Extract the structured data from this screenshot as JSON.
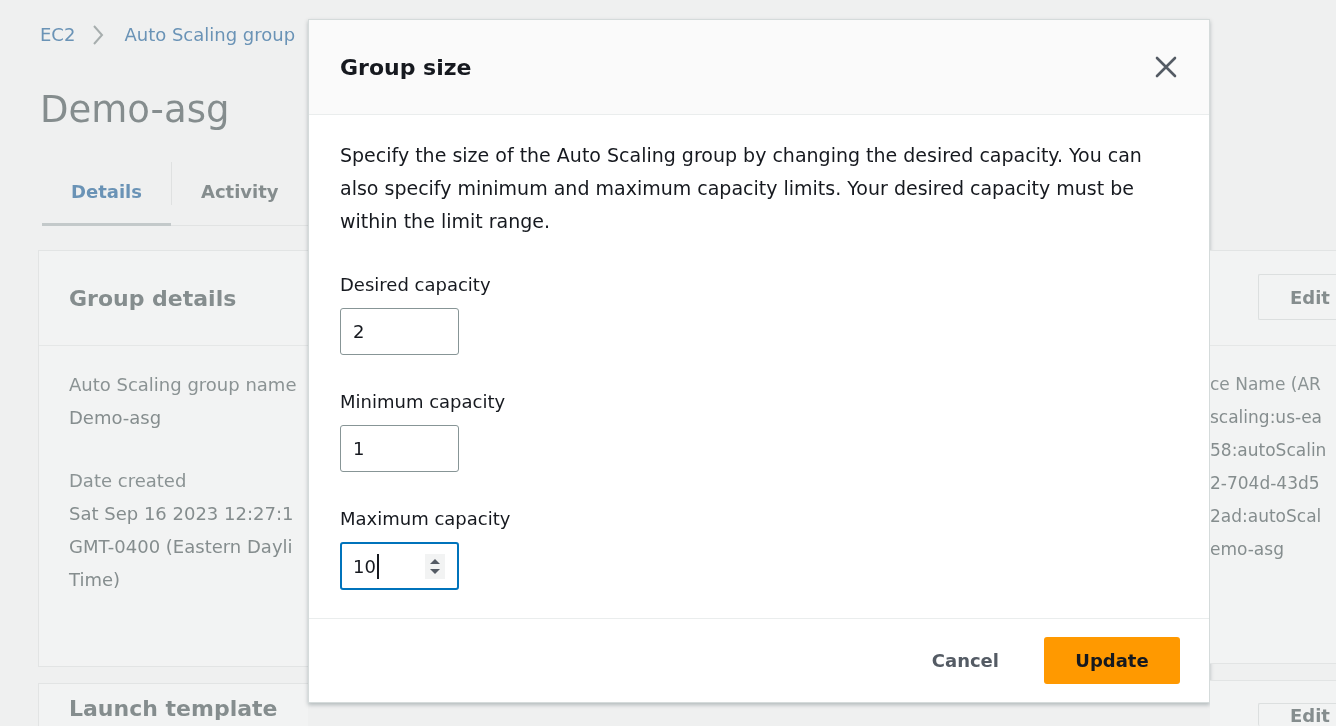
{
  "breadcrumbs": [
    {
      "label": "EC2"
    },
    {
      "label": "Auto Scaling group"
    }
  ],
  "page_title": "Demo-asg",
  "tabs": [
    {
      "label": "Details",
      "selected": true
    },
    {
      "label": "Activity",
      "selected": false
    }
  ],
  "group_details": {
    "title": "Group details",
    "edit_button": "Edit",
    "fields": [
      {
        "label": "Auto Scaling group name",
        "value_lines": [
          "Demo-asg"
        ]
      },
      {
        "label": "Date created",
        "value_lines": [
          "Sat Sep 16 2023 12:27:1",
          "GMT-0400 (Eastern Dayli",
          "Time)"
        ]
      }
    ],
    "arn_field": {
      "label": "ce Name (AR",
      "value_lines": [
        "scaling:us-ea",
        "58:autoScalin",
        "2-704d-43d5",
        "2ad:autoScal",
        "emo-asg"
      ]
    }
  },
  "launch_template": {
    "title": "Launch template",
    "edit_button": "Edit"
  },
  "dialog": {
    "title": "Group size",
    "description": "Specify the size of the Auto Scaling group by changing the desired capacity. You can also specify minimum and maximum capacity limits. Your desired capacity must be within the limit range.",
    "fields": [
      {
        "label": "Desired capacity",
        "value": "2",
        "focused": false
      },
      {
        "label": "Minimum capacity",
        "value": "1",
        "focused": false
      },
      {
        "label": "Maximum capacity",
        "value": "10",
        "focused": true
      }
    ],
    "buttons": [
      {
        "label": "Cancel",
        "kind": "link"
      },
      {
        "label": "Update",
        "kind": "primary"
      }
    ]
  }
}
